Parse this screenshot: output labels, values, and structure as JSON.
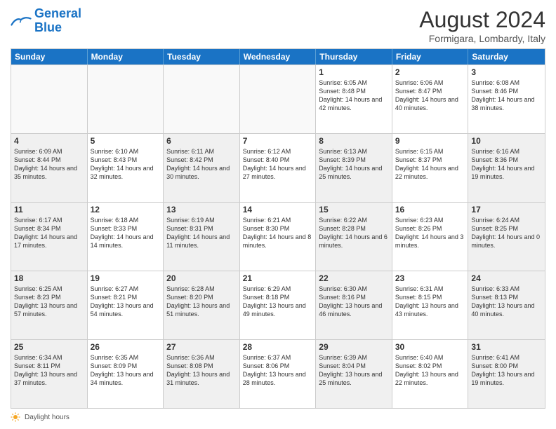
{
  "header": {
    "month_year": "August 2024",
    "location": "Formigara, Lombardy, Italy"
  },
  "logo": {
    "line1": "General",
    "line2": "Blue"
  },
  "days_of_week": [
    "Sunday",
    "Monday",
    "Tuesday",
    "Wednesday",
    "Thursday",
    "Friday",
    "Saturday"
  ],
  "footer_label": "Daylight hours",
  "weeks": [
    [
      {
        "day": "",
        "info": "",
        "empty": true
      },
      {
        "day": "",
        "info": "",
        "empty": true
      },
      {
        "day": "",
        "info": "",
        "empty": true
      },
      {
        "day": "",
        "info": "",
        "empty": true
      },
      {
        "day": "1",
        "info": "Sunrise: 6:05 AM\nSunset: 8:48 PM\nDaylight: 14 hours\nand 42 minutes."
      },
      {
        "day": "2",
        "info": "Sunrise: 6:06 AM\nSunset: 8:47 PM\nDaylight: 14 hours\nand 40 minutes."
      },
      {
        "day": "3",
        "info": "Sunrise: 6:08 AM\nSunset: 8:46 PM\nDaylight: 14 hours\nand 38 minutes."
      }
    ],
    [
      {
        "day": "4",
        "info": "Sunrise: 6:09 AM\nSunset: 8:44 PM\nDaylight: 14 hours\nand 35 minutes.",
        "shaded": true
      },
      {
        "day": "5",
        "info": "Sunrise: 6:10 AM\nSunset: 8:43 PM\nDaylight: 14 hours\nand 32 minutes."
      },
      {
        "day": "6",
        "info": "Sunrise: 6:11 AM\nSunset: 8:42 PM\nDaylight: 14 hours\nand 30 minutes.",
        "shaded": true
      },
      {
        "day": "7",
        "info": "Sunrise: 6:12 AM\nSunset: 8:40 PM\nDaylight: 14 hours\nand 27 minutes."
      },
      {
        "day": "8",
        "info": "Sunrise: 6:13 AM\nSunset: 8:39 PM\nDaylight: 14 hours\nand 25 minutes.",
        "shaded": true
      },
      {
        "day": "9",
        "info": "Sunrise: 6:15 AM\nSunset: 8:37 PM\nDaylight: 14 hours\nand 22 minutes."
      },
      {
        "day": "10",
        "info": "Sunrise: 6:16 AM\nSunset: 8:36 PM\nDaylight: 14 hours\nand 19 minutes.",
        "shaded": true
      }
    ],
    [
      {
        "day": "11",
        "info": "Sunrise: 6:17 AM\nSunset: 8:34 PM\nDaylight: 14 hours\nand 17 minutes.",
        "shaded": true
      },
      {
        "day": "12",
        "info": "Sunrise: 6:18 AM\nSunset: 8:33 PM\nDaylight: 14 hours\nand 14 minutes."
      },
      {
        "day": "13",
        "info": "Sunrise: 6:19 AM\nSunset: 8:31 PM\nDaylight: 14 hours\nand 11 minutes.",
        "shaded": true
      },
      {
        "day": "14",
        "info": "Sunrise: 6:21 AM\nSunset: 8:30 PM\nDaylight: 14 hours\nand 8 minutes."
      },
      {
        "day": "15",
        "info": "Sunrise: 6:22 AM\nSunset: 8:28 PM\nDaylight: 14 hours\nand 6 minutes.",
        "shaded": true
      },
      {
        "day": "16",
        "info": "Sunrise: 6:23 AM\nSunset: 8:26 PM\nDaylight: 14 hours\nand 3 minutes."
      },
      {
        "day": "17",
        "info": "Sunrise: 6:24 AM\nSunset: 8:25 PM\nDaylight: 14 hours\nand 0 minutes.",
        "shaded": true
      }
    ],
    [
      {
        "day": "18",
        "info": "Sunrise: 6:25 AM\nSunset: 8:23 PM\nDaylight: 13 hours\nand 57 minutes.",
        "shaded": true
      },
      {
        "day": "19",
        "info": "Sunrise: 6:27 AM\nSunset: 8:21 PM\nDaylight: 13 hours\nand 54 minutes."
      },
      {
        "day": "20",
        "info": "Sunrise: 6:28 AM\nSunset: 8:20 PM\nDaylight: 13 hours\nand 51 minutes.",
        "shaded": true
      },
      {
        "day": "21",
        "info": "Sunrise: 6:29 AM\nSunset: 8:18 PM\nDaylight: 13 hours\nand 49 minutes."
      },
      {
        "day": "22",
        "info": "Sunrise: 6:30 AM\nSunset: 8:16 PM\nDaylight: 13 hours\nand 46 minutes.",
        "shaded": true
      },
      {
        "day": "23",
        "info": "Sunrise: 6:31 AM\nSunset: 8:15 PM\nDaylight: 13 hours\nand 43 minutes."
      },
      {
        "day": "24",
        "info": "Sunrise: 6:33 AM\nSunset: 8:13 PM\nDaylight: 13 hours\nand 40 minutes.",
        "shaded": true
      }
    ],
    [
      {
        "day": "25",
        "info": "Sunrise: 6:34 AM\nSunset: 8:11 PM\nDaylight: 13 hours\nand 37 minutes.",
        "shaded": true
      },
      {
        "day": "26",
        "info": "Sunrise: 6:35 AM\nSunset: 8:09 PM\nDaylight: 13 hours\nand 34 minutes."
      },
      {
        "day": "27",
        "info": "Sunrise: 6:36 AM\nSunset: 8:08 PM\nDaylight: 13 hours\nand 31 minutes.",
        "shaded": true
      },
      {
        "day": "28",
        "info": "Sunrise: 6:37 AM\nSunset: 8:06 PM\nDaylight: 13 hours\nand 28 minutes."
      },
      {
        "day": "29",
        "info": "Sunrise: 6:39 AM\nSunset: 8:04 PM\nDaylight: 13 hours\nand 25 minutes.",
        "shaded": true
      },
      {
        "day": "30",
        "info": "Sunrise: 6:40 AM\nSunset: 8:02 PM\nDaylight: 13 hours\nand 22 minutes."
      },
      {
        "day": "31",
        "info": "Sunrise: 6:41 AM\nSunset: 8:00 PM\nDaylight: 13 hours\nand 19 minutes.",
        "shaded": true
      }
    ]
  ]
}
